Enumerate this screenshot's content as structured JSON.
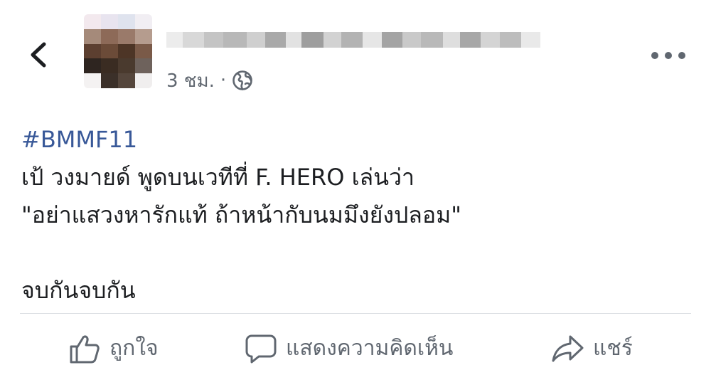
{
  "header": {
    "back_icon": "chevron-left-icon",
    "time": "3 ชม.",
    "separator": "·",
    "privacy_icon": "globe-icon",
    "more_icon": "more-horizontal-icon"
  },
  "post": {
    "hashtag": "#BMMF11",
    "line1": "เป้ วงมายด์ พูดบนเวทีที่ F. HERO เล่นว่า",
    "line2": "\"อย่าแสวงหารักแท้ ถ้าหน้ากับนมมึงยังปลอม\"",
    "line3": "จบกันจบกัน"
  },
  "actions": {
    "like_label": "ถูกใจ",
    "comment_label": "แสดงความคิดเห็น",
    "share_label": "แชร์"
  },
  "colors": {
    "link": "#385898",
    "muted": "#606770",
    "divider": "#dadde1"
  }
}
